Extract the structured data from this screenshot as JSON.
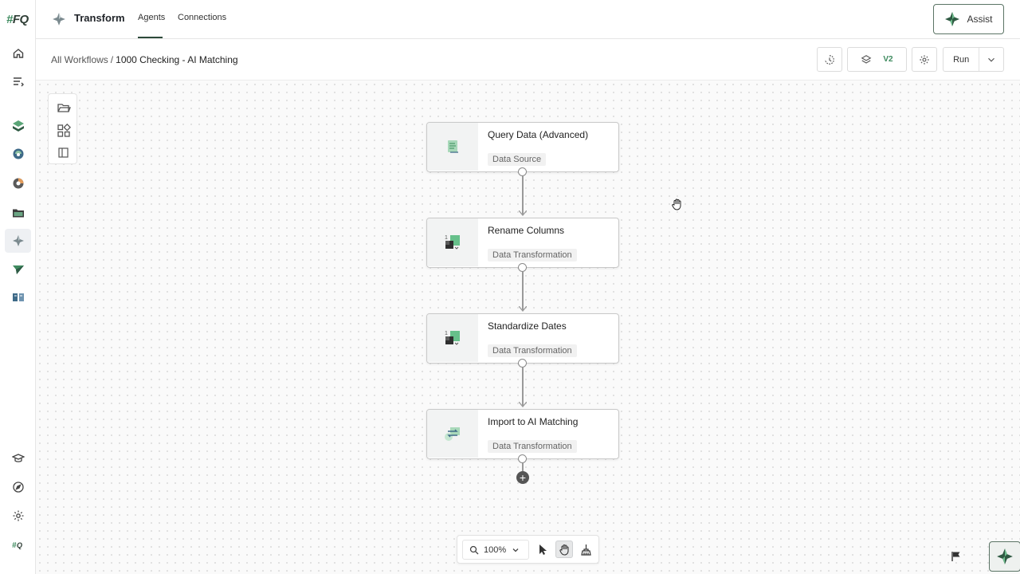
{
  "rail": {
    "logo_hash": "#",
    "logo_text": "FQ",
    "items_top": [
      "home-icon",
      "list-icon"
    ],
    "items_apps": [
      "ledger-icon",
      "reconcile-icon",
      "analytics-icon",
      "folder-icon",
      "transform-icon",
      "send-icon",
      "book-icon"
    ],
    "items_bottom": [
      "academy-icon",
      "compass-icon",
      "settings-icon",
      "fq-mini-logo-icon"
    ]
  },
  "header": {
    "app_title": "Transform",
    "tabs": [
      {
        "label": "Agents",
        "active": true
      },
      {
        "label": "Connections",
        "active": false
      }
    ],
    "assist_label": "Assist"
  },
  "breadcrumb": {
    "root": "All Workflows",
    "separator": "/",
    "current": "1000 Checking - AI Matching"
  },
  "toolbar": {
    "version": "V2",
    "run_label": "Run"
  },
  "workflow": {
    "nodes": [
      {
        "title": "Query Data (Advanced)",
        "type": "Data Source",
        "icon": "query-data-icon"
      },
      {
        "title": "Rename Columns",
        "type": "Data Transformation",
        "icon": "transform-table-icon"
      },
      {
        "title": "Standardize Dates",
        "type": "Data Transformation",
        "icon": "transform-table-icon"
      },
      {
        "title": "Import to AI Matching",
        "type": "Data Transformation",
        "icon": "import-sync-icon"
      }
    ],
    "add_symbol": "+"
  },
  "canvas_controls": {
    "zoom": "100%",
    "active_tool": "pan"
  },
  "colors": {
    "accent": "#3d8a5e",
    "border_dark": "#5b7465"
  }
}
